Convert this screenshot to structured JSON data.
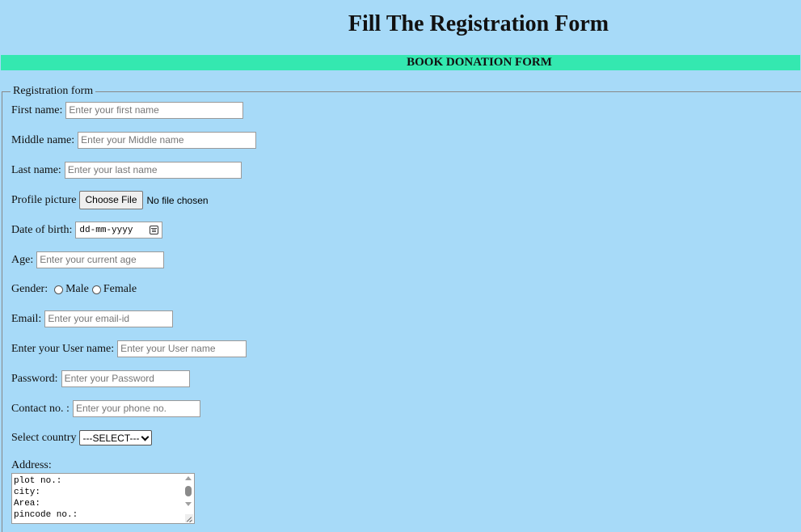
{
  "header": {
    "title": "Fill The Registration Form",
    "banner": "BOOK DONATION FORM"
  },
  "form": {
    "legend": "Registration form",
    "first_name": {
      "label": "First name:",
      "placeholder": "Enter your first name"
    },
    "middle_name": {
      "label": "Middle name:",
      "placeholder": "Enter your Middle name"
    },
    "last_name": {
      "label": "Last name:",
      "placeholder": "Enter your last name"
    },
    "profile_picture": {
      "label": "Profile picture",
      "button": "Choose File",
      "status": "No file chosen"
    },
    "dob": {
      "label": "Date of birth:",
      "value": "dd-mm-yyyy"
    },
    "age": {
      "label": "Age:",
      "placeholder": "Enter your current age"
    },
    "gender": {
      "label": "Gender:",
      "options": [
        "Male",
        "Female"
      ]
    },
    "email": {
      "label": "Email:",
      "placeholder": "Enter your email-id"
    },
    "username": {
      "label": "Enter your User name:",
      "placeholder": "Enter your User name"
    },
    "password": {
      "label": "Password:",
      "placeholder": "Enter your Password"
    },
    "contact": {
      "label": "Contact no. :",
      "placeholder": "Enter your phone no."
    },
    "country": {
      "label": "Select country",
      "selected": "---SELECT---"
    },
    "address": {
      "label": "Address:",
      "lines": [
        "plot no.:",
        "city:",
        "Area:",
        "pincode no.:"
      ]
    }
  },
  "icons": {
    "calendar": "calendar-icon",
    "dropdown": "chevron-down-icon"
  },
  "colors": {
    "page_bg": "#a7daf8",
    "banner_bg": "#34e8b0"
  }
}
